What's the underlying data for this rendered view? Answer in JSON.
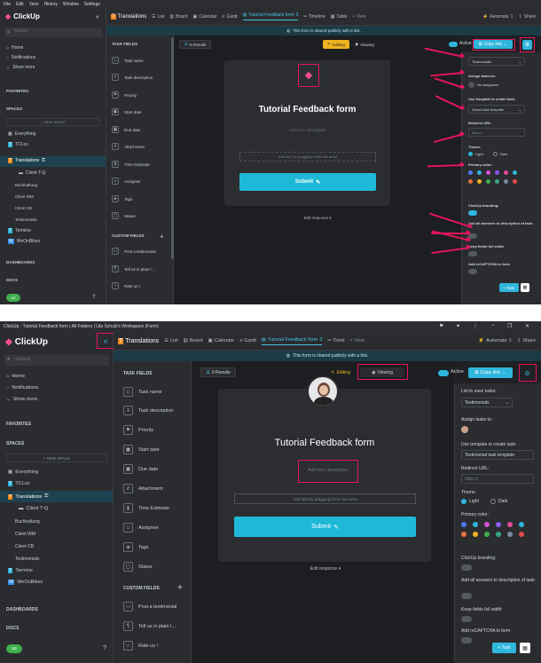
{
  "top": {
    "menubar": [
      "File",
      "Edit",
      "View",
      "History",
      "Window",
      "Settings"
    ],
    "app_name": "ClickUp",
    "search_placeholder": "Search",
    "nav": [
      "Home",
      "Notifications",
      "Show more"
    ],
    "favorites": "FAVORITES",
    "spaces": "SPACES",
    "new_space": "+ NEW SPACE",
    "space_items": [
      "Everything",
      "TCLoc",
      "Translations",
      "Client T-Q",
      "Buchhaltung",
      "Client WM",
      "Client CB",
      "Testimonials",
      "Termine",
      "WeOnBikes"
    ],
    "dashboards": "DASHBOARDS",
    "docs": "DOCS",
    "avatar_initials": "UE",
    "breadcrumb": "Translations",
    "tabs": [
      "List",
      "Board",
      "Calendar",
      "Gantt",
      "Tutorial Feedback form",
      "Timeline",
      "Table",
      "+ View"
    ],
    "tab_badge": "3",
    "automate": "Automate",
    "automate_count": "1",
    "share": "Share",
    "banner": "This form is shared publicly with a link.",
    "results": "0 Results",
    "editing": "Editing",
    "viewing": "Viewing",
    "active": "Active",
    "copy_link": "Copy link",
    "task_fields": "TASK FIELDS",
    "fields": [
      "Task name",
      "Task description",
      "Priority",
      "Start date",
      "Due date",
      "Attachment",
      "Time Estimate",
      "Assignee",
      "Tags",
      "Status"
    ],
    "custom_fields": "CUSTOM FIELDS",
    "custom": [
      "Post a testimonial",
      "Tell us in plain l...",
      "Rate us !"
    ],
    "form_title": "Tutorial Feedback form",
    "form_desc_placeholder": "Add form description",
    "drop_hint": "Add field by dragging it into this area!",
    "submit": "Submit",
    "edit_response": "Edit response",
    "list_to_save": "Testimonials",
    "assign_tasks_to": "Assign tasks to:",
    "no_assignees": "No assignees",
    "use_template": "Use template to create task:",
    "select_template": "Select task template",
    "redirect_url": "Redirect URL:",
    "redirect_placeholder": "https://",
    "theme": "Theme:",
    "light": "Light",
    "dark": "Dark",
    "primary_color": "Primary color:",
    "clickup_branding": "ClickUp branding:",
    "add_all_answers": "Add all answers to description of task:",
    "keep_fields": "Keep fields full width",
    "add_recaptcha": "Add reCAPTCHA to form",
    "task_btn": "+ Task"
  },
  "bottom": {
    "window_title": "ClickUp - Tutorial Feedback form | All Folders | Uta Schulz's Workspace (Form)",
    "app_name": "ClickUp",
    "search_placeholder": "Search",
    "nav": [
      "Home",
      "Notifications",
      "Show more"
    ],
    "favorites": "FAVORITES",
    "spaces": "SPACES",
    "new_space": "+ NEW SPACE",
    "space_items": [
      "Everything",
      "TCLoc",
      "Translations",
      "Client T-Q",
      "Buchhaltung",
      "Client WM",
      "Client CB",
      "Testimonials",
      "Termine",
      "WeOnBikes"
    ],
    "dashboards": "DASHBOARDS",
    "docs": "DOCS",
    "avatar_initials": "UE",
    "breadcrumb": "Translations",
    "tabs": [
      "List",
      "Board",
      "Calendar",
      "Gantt",
      "Tutorial Feedback form",
      "Timel",
      "+ View"
    ],
    "tab_badge": "3",
    "automate": "Automate",
    "automate_count": "1",
    "share": "Share",
    "banner": "This form is shared publicly with a link.",
    "results": "0 Results",
    "editing": "Editing",
    "viewing": "Viewing",
    "active": "Active",
    "copy_link": "Copy link",
    "task_fields": "TASK FIELDS",
    "fields": [
      "Task name",
      "Task description",
      "Priority",
      "Start date",
      "Due date",
      "Attachment",
      "Time Estimate",
      "Assignee",
      "Tags",
      "Status"
    ],
    "custom_fields": "CUSTOM FIELDS",
    "custom": [
      "Post a testimonial",
      "Tell us in plain l...",
      "Rate us !"
    ],
    "form_title": "Tutorial Feedback form",
    "form_desc_placeholder": "Add form description",
    "drop_hint": "Add field by dragging it into this area",
    "submit": "Submit",
    "edit_response": "Edit response",
    "list_to_save_label": "List to save tasks:",
    "list_to_save": "Testimonials",
    "assign_tasks_to": "Assign tasks to:",
    "use_template": "Use template to create task:",
    "template_value": "Testimonial task template",
    "redirect_url": "Redirect URL:",
    "redirect_placeholder": "https://",
    "theme": "Theme:",
    "light": "Light",
    "dark": "Dark",
    "primary_color": "Primary color:",
    "clickup_branding": "ClickUp branding:",
    "add_all_answers": "Add all answers to description of task:",
    "keep_fields": "Keep fields full width",
    "add_recaptcha": "Add reCAPTCHA to form",
    "task_btn": "+ Task"
  },
  "colors": {
    "accent": "#2fb6dc",
    "highlight": "#e3165b",
    "swatches_row1": [
      "#4f7bf7",
      "#2fb6dc",
      "#d44fd6",
      "#8c57f2",
      "#e34b9a",
      "#2fb6dc"
    ],
    "swatches_row2": [
      "#e8713a",
      "#f2b31f",
      "#3fb04d",
      "#3aa58a",
      "#7b8a9c",
      "#e34b4b"
    ]
  }
}
